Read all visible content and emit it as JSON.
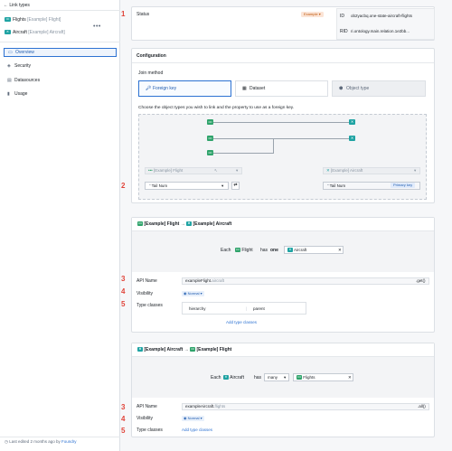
{
  "sidebar": {
    "back_label": "Link types",
    "link_a": {
      "name": "Flights",
      "suffix": "[Example] Flight]"
    },
    "link_b": {
      "name": "Aircraft",
      "suffix": "[Example] Aircraft]"
    },
    "nav": [
      {
        "label": "Overview"
      },
      {
        "label": "Security"
      },
      {
        "label": "Datasources"
      },
      {
        "label": "Usage"
      }
    ],
    "footer_text": "Last edited 2 months ago by",
    "footer_link": "Foundry"
  },
  "markers": [
    "1",
    "2",
    "3",
    "4",
    "5",
    "3",
    "4",
    "5"
  ],
  "status": {
    "label": "Status",
    "tag": "Example",
    "id_key": "ID",
    "id_value": "ob2yacbq.one-state-aircraft-flights",
    "rid_key": "RID",
    "rid_value": "ri.ontology.main.relation.1e2bb..."
  },
  "config": {
    "title": "Configuration",
    "join_label": "Join method",
    "methods": [
      {
        "label": "Foreign key",
        "icon": "key-icon"
      },
      {
        "label": "Dataset",
        "icon": "dataset-icon"
      },
      {
        "label": "Object type",
        "icon": "cube-icon"
      }
    ],
    "help_text": "Choose the object types you wish to link and the property to use as a foreign key.",
    "left_object": "[Example] Flight",
    "left_prop": "Tail Num",
    "right_object": "[Example] Aircraft",
    "right_prop": "Tail Num",
    "pk_tag": "Primary key"
  },
  "link1": {
    "from": "[Example] Flight",
    "to": "[Example] Aircraft",
    "each": "Each",
    "obj": "Flight",
    "has": "has",
    "card": "one",
    "target": "Aircraft",
    "api_label": "API Name",
    "api_value": "exampleFlight.",
    "api_placeholder": "aircraft",
    "api_suffix": ".get()",
    "vis_label": "Visibility",
    "vis_value": "Normal",
    "tc_label": "Type classes",
    "tc_key": "hierarchy",
    "tc_val": "parent",
    "add_tc": "Add type classes"
  },
  "link2": {
    "from": "[Example] Aircraft",
    "to": "[Example] Flight",
    "each": "Each",
    "obj": "Aircraft",
    "has": "has",
    "card": "many",
    "target": "Flights",
    "api_label": "API Name",
    "api_value": "exampleAircraft.",
    "api_placeholder": "flights",
    "api_suffix": ".all()",
    "vis_label": "Visibility",
    "vis_value": "Normal",
    "tc_label": "Type classes",
    "add_tc": "Add type classes"
  }
}
